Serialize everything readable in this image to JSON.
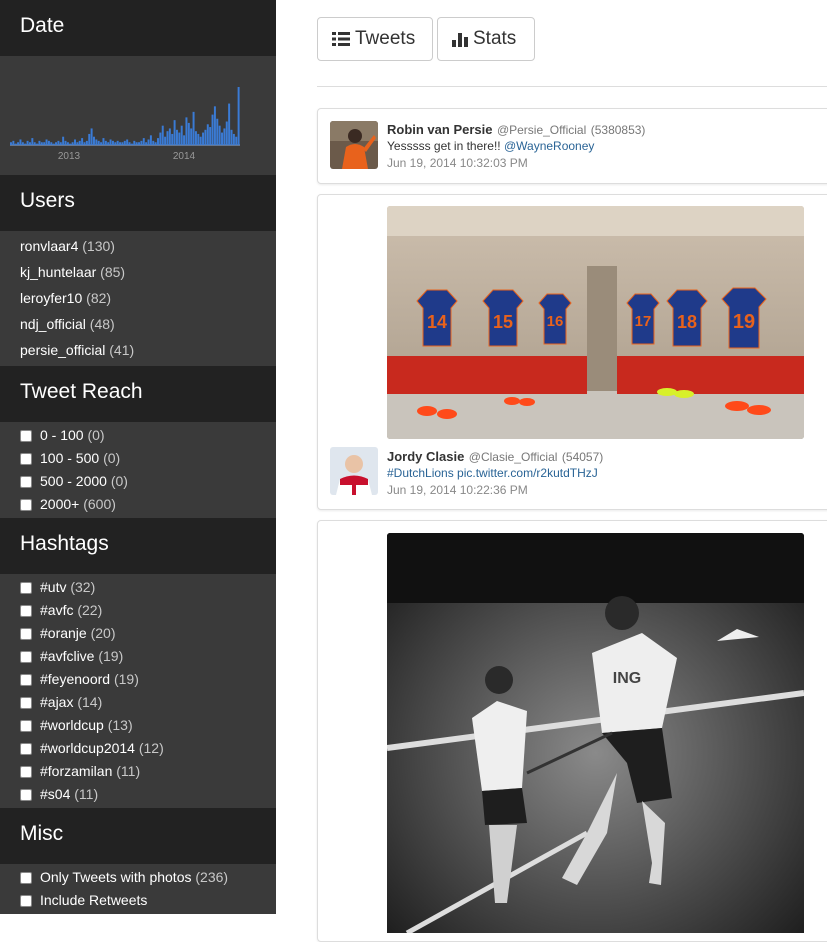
{
  "sidebar": {
    "date": {
      "title": "Date",
      "axis_labels": [
        "2013",
        "2014"
      ],
      "bar_color": "#3a7bd5",
      "bars": [
        2,
        3,
        1,
        2,
        4,
        2,
        1,
        3,
        2,
        5,
        2,
        1,
        3,
        2,
        2,
        4,
        3,
        2,
        1,
        2,
        3,
        2,
        6,
        3,
        2,
        1,
        2,
        4,
        2,
        3,
        5,
        2,
        3,
        8,
        12,
        6,
        4,
        3,
        2,
        5,
        3,
        2,
        4,
        3,
        2,
        3,
        2,
        2,
        3,
        4,
        2,
        1,
        3,
        2,
        2,
        3,
        5,
        2,
        4,
        7,
        3,
        2,
        5,
        9,
        14,
        6,
        10,
        12,
        8,
        18,
        11,
        9,
        14,
        7,
        20,
        16,
        12,
        24,
        10,
        8,
        6,
        9,
        11,
        15,
        13,
        22,
        28,
        19,
        14,
        9,
        12,
        17,
        30,
        11,
        8,
        6,
        42
      ]
    },
    "users": {
      "title": "Users",
      "items": [
        {
          "name": "ronvlaar4",
          "count": "(130)"
        },
        {
          "name": "kj_huntelaar",
          "count": "(85)"
        },
        {
          "name": "leroyfer10",
          "count": "(82)"
        },
        {
          "name": "ndj_official",
          "count": "(48)"
        },
        {
          "name": "persie_official",
          "count": "(41)"
        }
      ]
    },
    "reach": {
      "title": "Tweet Reach",
      "items": [
        {
          "label": "0 - 100",
          "count": "(0)"
        },
        {
          "label": "100 - 500",
          "count": "(0)"
        },
        {
          "label": "500 - 2000",
          "count": "(0)"
        },
        {
          "label": "2000+",
          "count": "(600)"
        }
      ]
    },
    "hashtags": {
      "title": "Hashtags",
      "items": [
        {
          "label": "#utv",
          "count": "(32)"
        },
        {
          "label": "#avfc",
          "count": "(22)"
        },
        {
          "label": "#oranje",
          "count": "(20)"
        },
        {
          "label": "#avfclive",
          "count": "(19)"
        },
        {
          "label": "#feyenoord",
          "count": "(19)"
        },
        {
          "label": "#ajax",
          "count": "(14)"
        },
        {
          "label": "#worldcup",
          "count": "(13)"
        },
        {
          "label": "#worldcup2014",
          "count": "(12)"
        },
        {
          "label": "#forzamilan",
          "count": "(11)"
        },
        {
          "label": "#s04",
          "count": "(11)"
        }
      ]
    },
    "misc": {
      "title": "Misc",
      "items": [
        {
          "label": "Only Tweets with photos",
          "count": "(236)"
        },
        {
          "label": "Include Retweets",
          "count": ""
        }
      ]
    }
  },
  "toolbar": {
    "tweets_label": "Tweets",
    "stats_label": "Stats"
  },
  "tweets": [
    {
      "name": "Robin van Persie",
      "handle": "@Persie_Official",
      "reach": "(5380853)",
      "text": "Yesssss get in there!! ",
      "link": "@WayneRooney",
      "date": "Jun 19, 2014 10:32:03 PM"
    },
    {
      "name": "Jordy Clasie",
      "handle": "@Clasie_Official",
      "reach": "(54057)",
      "text": "",
      "link": "#DutchLions pic.twitter.com/r2kutdTHzJ",
      "date": "Jun 19, 2014 10:22:36 PM",
      "photo_jersey_numbers": [
        "14",
        "15",
        "16",
        "17",
        "18",
        "19"
      ]
    },
    {
      "photo_shirt_text": "ING"
    }
  ]
}
